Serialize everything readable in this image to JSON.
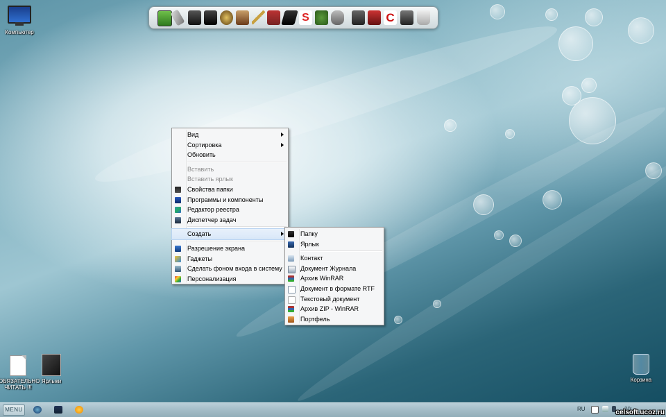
{
  "desktop_icons": {
    "computer": {
      "label": "Компьютер",
      "icon": "computer-icon"
    },
    "readme": {
      "label": "ОБЯЗАТЕЛЬНО ЧИТАТЬ !!!",
      "icon": "text-file-icon"
    },
    "shortcuts": {
      "label": "Ярлыки",
      "icon": "folder-icon"
    },
    "recycle_bin": {
      "label": "Корзина",
      "icon": "recycle-bin-icon"
    }
  },
  "dock": {
    "items": [
      "monitor",
      "usb-stick",
      "screen",
      "book",
      "hat",
      "photo",
      "pen",
      "house",
      "pencil",
      "s-logo",
      "tree",
      "mouse",
      "camera",
      "car",
      "c-logo",
      "media-player",
      "cup"
    ]
  },
  "context_menu": {
    "items": [
      {
        "label": "Вид",
        "submenu": true
      },
      {
        "label": "Сортировка",
        "submenu": true
      },
      {
        "label": "Обновить"
      },
      {
        "label": "Вставить",
        "disabled": true
      },
      {
        "label": "Вставить ярлык",
        "disabled": true
      },
      {
        "label": "Свойства папки",
        "icon": "folder-properties-icon"
      },
      {
        "label": "Программы и компоненты",
        "icon": "programs-icon"
      },
      {
        "label": "Редактор реестра",
        "icon": "registry-editor-icon"
      },
      {
        "label": "Диспетчер задач",
        "icon": "task-manager-icon"
      },
      {
        "label": "Создать",
        "submenu": true
      },
      {
        "label": "Разрешение экрана",
        "icon": "screen-resolution-icon"
      },
      {
        "label": "Гаджеты",
        "icon": "gadgets-icon"
      },
      {
        "label": "Сделать фоном входа в систему",
        "icon": "wallpaper-icon"
      },
      {
        "label": "Персонализация",
        "icon": "personalization-icon"
      }
    ]
  },
  "create_submenu": {
    "items": [
      {
        "label": "Папку",
        "icon": "folder-icon"
      },
      {
        "label": "Ярлык",
        "icon": "shortcut-icon"
      },
      {
        "label": "Контакт",
        "icon": "contact-icon"
      },
      {
        "label": "Документ Журнала",
        "icon": "journal-icon"
      },
      {
        "label": "Архив WinRAR",
        "icon": "winrar-icon"
      },
      {
        "label": "Документ в формате RTF",
        "icon": "rtf-icon"
      },
      {
        "label": "Текстовый документ",
        "icon": "text-document-icon"
      },
      {
        "label": "Архив ZIP - WinRAR",
        "icon": "zip-icon"
      },
      {
        "label": "Портфель",
        "icon": "briefcase-icon"
      }
    ]
  },
  "taskbar": {
    "start_label": "MENU",
    "pinned": [
      "internet-explorer-icon",
      "explorer-icon",
      "media-player-icon"
    ],
    "language": "RU",
    "clock_partial": "20:..",
    "watermark": "celsoft.ucoz.ru"
  },
  "colors": {
    "menu_bg": "#f5f6f7",
    "menu_highlight": "#d8e7f8",
    "taskbar": "#a3bcc7"
  }
}
